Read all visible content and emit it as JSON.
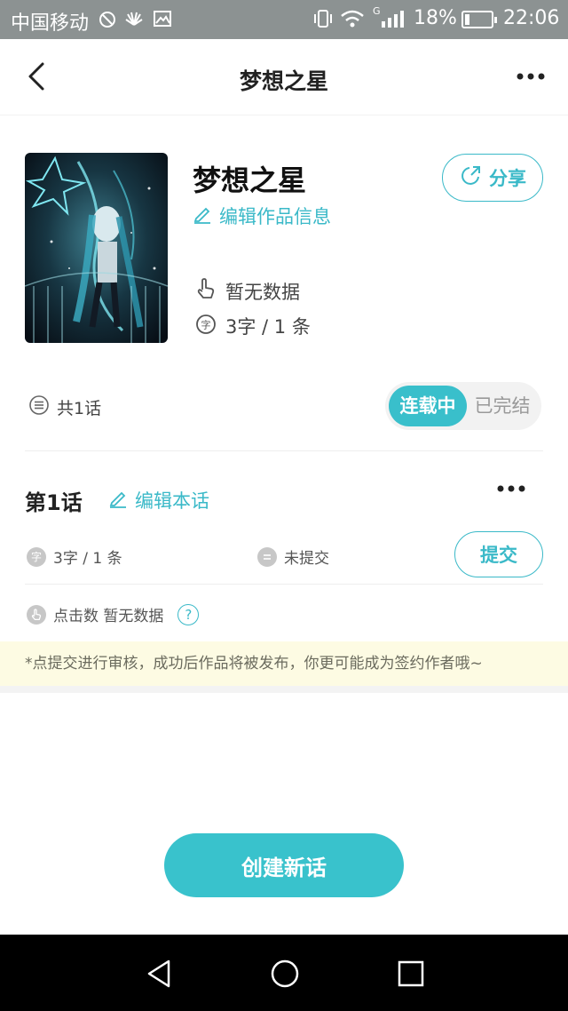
{
  "status_bar": {
    "carrier": "中国移动",
    "signal_tag": "G",
    "battery_percent": "18%",
    "battery_level": 0.18,
    "time": "22:06"
  },
  "navbar": {
    "title": "梦想之星",
    "back_icon": "back-arrow-icon",
    "more_icon": "more-dots-icon"
  },
  "work": {
    "title": "梦想之星",
    "edit_label": "编辑作品信息",
    "share_label": "分享",
    "clicks_text": "暂无数据",
    "words_text": "3字 / 1 条"
  },
  "episodes": {
    "count_label": "共1话",
    "status_options": [
      "连载中",
      "已完结"
    ],
    "selected_status": "连载中"
  },
  "episode": {
    "title": "第1话",
    "edit_label": "编辑本话",
    "words_text": "3字 / 1 条",
    "word_icon_glyph": "字",
    "state_text": "未提交",
    "submit_label": "提交",
    "clicks_label": "点击数 暂无数据",
    "help_glyph": "?"
  },
  "tip": "*点提交进行审核，成功后作品将被发布，你更可能成为签约作者哦~",
  "create_button": "创建新话",
  "colors": {
    "accent": "#39c2cc",
    "status_bar": "#8c9292",
    "tip_bg": "#fdfbe3"
  }
}
